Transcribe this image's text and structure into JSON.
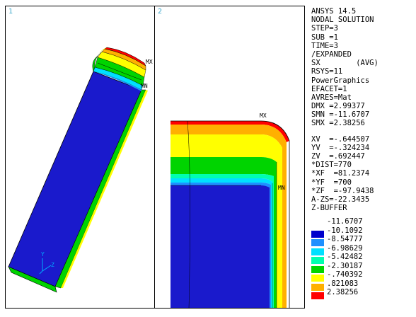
{
  "viewports": [
    {
      "number": "1",
      "max_label": "MX",
      "min_label": "MN",
      "triad": {
        "y": "Y",
        "z": "Z"
      }
    },
    {
      "number": "2",
      "max_label": "MX",
      "min_label": "MN"
    }
  ],
  "info_panel": {
    "lines": [
      "ANSYS 14.5",
      "NODAL SOLUTION",
      "STEP=3",
      "SUB =1",
      "TIME=3",
      "/EXPANDED",
      "SX        (AVG)",
      "RSYS=11",
      "PowerGraphics",
      "EFACET=1",
      "AVRES=Mat",
      "DMX =2.99377",
      "SMN =-11.6707",
      "SMX =2.38256"
    ],
    "view_lines": [
      "XV  =-.644507",
      "YV  =-.324234",
      "ZV  =.692447",
      "*DIST=770",
      "*XF  =81.2374",
      "*YF  =700",
      "*ZF  =-97.9438",
      "A-ZS=-22.3435",
      "Z-BUFFER"
    ]
  },
  "legend": {
    "top_label": "-11.6707",
    "bands": [
      {
        "color": "#0000cc",
        "label": "-10.1092"
      },
      {
        "color": "#1e90ff",
        "label": "-8.54777"
      },
      {
        "color": "#00e0ff",
        "label": "-6.98629"
      },
      {
        "color": "#00ffb0",
        "label": "-5.42482"
      },
      {
        "color": "#00d400",
        "label": "-2.30187"
      },
      {
        "color": "#ffff00",
        "label": "-.740392"
      },
      {
        "color": "#ffb000",
        "label": ".821083"
      },
      {
        "color": "#ff0000",
        "label": "2.38256"
      }
    ]
  },
  "colors": {
    "blue": "#1a1acc",
    "light_blue": "#1e90ff",
    "cyan": "#00e0ff",
    "aqua": "#00ffb0",
    "green": "#00d400",
    "yellow": "#ffff00",
    "orange": "#ffb000",
    "red": "#ff0000"
  }
}
